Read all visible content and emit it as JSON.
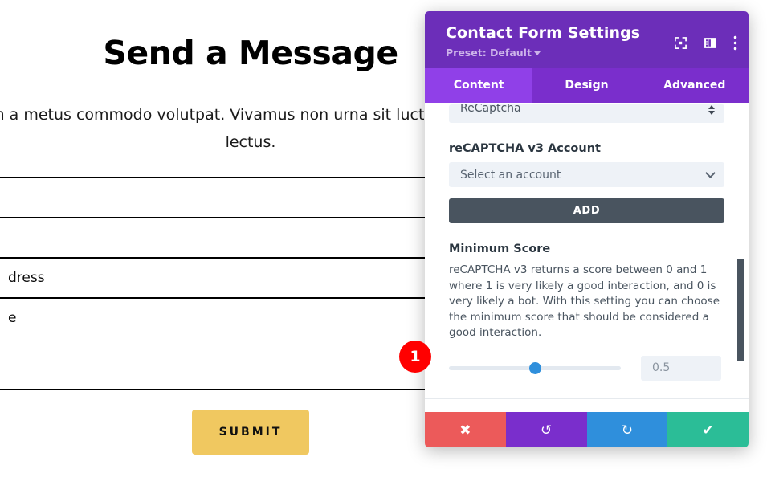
{
  "page": {
    "title": "Send a Message",
    "subtitle": "msan quam a metus commodo volutpat. Vivamus non urna sit luctus. Nulla eu tincidunt lectus.",
    "fields": [
      {
        "label": ""
      },
      {
        "label": ""
      },
      {
        "label": "dress"
      },
      {
        "label": "e"
      }
    ],
    "submit_label": "SUBMIT"
  },
  "modal": {
    "title": "Contact Form Settings",
    "preset_label": "Preset: Default",
    "header_icons": [
      {
        "name": "focus-icon"
      },
      {
        "name": "layout-panel-icon"
      },
      {
        "name": "more-vertical-icon"
      }
    ],
    "tabs": [
      {
        "label": "Content",
        "active": true
      },
      {
        "label": "Design",
        "active": false
      },
      {
        "label": "Advanced",
        "active": false
      }
    ],
    "body": {
      "spam_protection_value": "ReCaptcha",
      "account_label": "reCAPTCHA v3 Account",
      "account_value": "Select an account",
      "add_label": "ADD",
      "min_score_label": "Minimum Score",
      "min_score_help": "reCAPTCHA v3 returns a score between 0 and 1 where 1 is very likely a good interaction, and 0 is very likely a bot. With this setting you can choose the minimum score that should be considered a good interaction.",
      "min_score_value": "0.5",
      "slider_percent": 50
    },
    "footer": [
      {
        "name": "cancel",
        "glyph": "✖"
      },
      {
        "name": "undo",
        "glyph": "↺"
      },
      {
        "name": "redo",
        "glyph": "↻"
      },
      {
        "name": "save",
        "glyph": "✔"
      }
    ]
  },
  "annotation": {
    "number": "1"
  },
  "colors": {
    "header_purple": "#6c2eb9",
    "tabs_purple": "#7a2ecc",
    "tab_active_purple": "#9040e8",
    "cancel_red": "#ec5a5a",
    "redo_blue": "#2f8fdc",
    "save_green": "#2bbd97",
    "add_slate": "#49545f",
    "slider_blue": "#2f8fdc",
    "submit_gold": "#f0c860",
    "annotation_red": "#ff0000"
  }
}
